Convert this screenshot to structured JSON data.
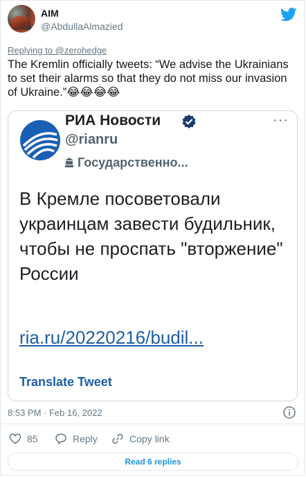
{
  "author": {
    "name": "AIM",
    "handle": "@AbdullaAlmazied"
  },
  "reply_context": {
    "prefix": "Replying to ",
    "target": "@zerohedge"
  },
  "tweet_text": "The Kremlin officially tweets: “We advise the Ukrainians to set their alarms so that they do not miss our invasion of Ukraine.”😂😂😂😂",
  "quoted": {
    "name": "РИА Новости",
    "handle": "@rianru",
    "gov_label": "Государственно...",
    "body": "В Кремле посоветовали украинцам завести будильник, чтобы не проспать \"вторжение\" России",
    "link": "ria.ru/20220216/budil...",
    "translate": "Translate Tweet",
    "more": "···"
  },
  "timestamp": "8:53 PM · Feb 16, 2022",
  "actions": {
    "likes": "85",
    "reply": "Reply",
    "copy_link": "Copy link"
  },
  "read_replies": "Read 6 replies",
  "colors": {
    "brand": "#1da1f2",
    "link": "#1d5ea7",
    "muted": "#657786"
  }
}
